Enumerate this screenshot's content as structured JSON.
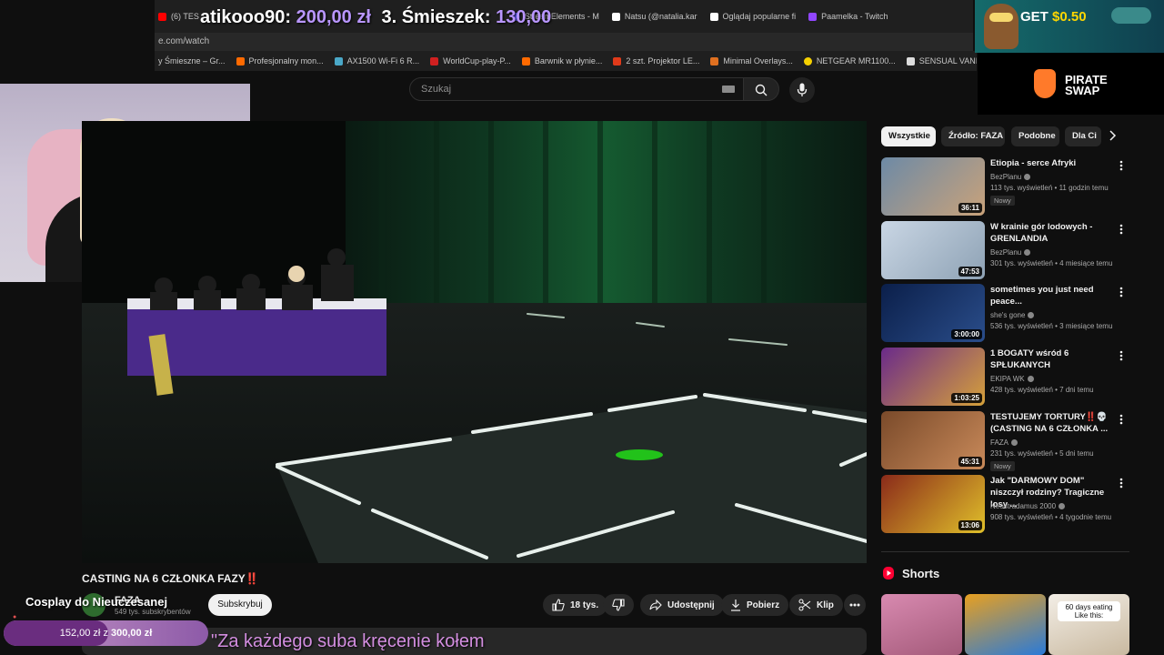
{
  "browser": {
    "tabs": [
      {
        "label": "(6) TES",
        "color": "#ff0000"
      },
      {
        "label": "StreamElements - M",
        "color": "#5c5cff"
      },
      {
        "label": "Natsu (@natalia.kar",
        "color": "#ffffff"
      },
      {
        "label": "Oglądaj popularne fi",
        "color": "#ffffff"
      },
      {
        "label": "Paamelka - Twitch",
        "color": "#9146ff"
      }
    ],
    "url": "e.com/watch",
    "bookmarks": [
      {
        "label": "y Śmieszne – Gr...",
        "color": "#777777"
      },
      {
        "label": "Profesjonalny mon...",
        "color": "#ff6a00"
      },
      {
        "label": "AX1500 Wi-Fi 6 R...",
        "color": "#4aa8c8"
      },
      {
        "label": "WorldCup-play-P...",
        "color": "#d02020"
      },
      {
        "label": "Barwnik w płynie...",
        "color": "#ff6a00"
      },
      {
        "label": "2 szt. Projektor LE...",
        "color": "#e03a1a"
      },
      {
        "label": "Minimal Overlays...",
        "color": "#e07020"
      },
      {
        "label": "NETGEAR MR1100...",
        "color": "#f5d000"
      },
      {
        "label": "SENSUAL VANILL...",
        "color": "#dddddd"
      }
    ]
  },
  "overlay": {
    "donation_user": "atikooo90:",
    "donation_amount": "200,00 zł",
    "donation_rank": "3.",
    "donation_user2": "Śmieszek:",
    "donation_amount2": "130,00",
    "ad_text": "GET",
    "ad_value": "$0.50",
    "logo_line1": "PIRATE",
    "logo_line2": "SWAP",
    "goal_title": "Cosplay do Nieuczesanej",
    "goal_current": "152,00 zł",
    "goal_sep": "z",
    "goal_target": "300,00 zł",
    "goal_progress": 0.51,
    "ticker": "\"Za każdego suba kręcenie kołem"
  },
  "search": {
    "placeholder": "Szukaj"
  },
  "video": {
    "title": "CASTING NA 6 CZŁONKA FAZY‼️",
    "channel": "FAZA",
    "subscribers": "549 tys. subskrybentów",
    "subscribe_label": "Subskrybuj",
    "likes": "18 tys.",
    "share_label": "Udostępnij",
    "download_label": "Pobierz",
    "clip_label": "Klip"
  },
  "sidebar": {
    "chips": [
      "Wszystkie",
      "Źródło: FAZA",
      "Podobne",
      "Dla Ci"
    ],
    "recommendations": [
      {
        "title": "Etiopia - serce Afryki",
        "channel": "BezPlanu",
        "meta": "113 tys. wyświetleń • 11 godzin temu",
        "badge": "Nowy",
        "duration": "36:11",
        "colors": [
          "#6d8aa6",
          "#c9a27a"
        ]
      },
      {
        "title": "W krainie gór lodowych - GRENLANDIA",
        "channel": "BezPlanu",
        "meta": "301 tys. wyświetleń • 4 miesiące temu",
        "badge": "",
        "duration": "47:53",
        "colors": [
          "#c9d6e4",
          "#8ea2b5"
        ]
      },
      {
        "title": "sometimes you just need peace...",
        "channel": "she's gone",
        "meta": "536 tys. wyświetleń • 3 miesiące temu",
        "badge": "",
        "duration": "3:00:00",
        "colors": [
          "#0b1f4a",
          "#2a4d8a"
        ]
      },
      {
        "title": "1 BOGATY wśród 6 SPŁUKANYCH",
        "channel": "EKIPA WK",
        "meta": "428 tys. wyświetleń • 7 dni temu",
        "badge": "",
        "duration": "1:03:25",
        "colors": [
          "#6a2a8a",
          "#d6a13a"
        ]
      },
      {
        "title": "TESTUJEMY TORTURY‼️💀 (CASTING NA 6 CZŁONKA ...",
        "channel": "FAZA",
        "meta": "231 tys. wyświetleń • 5 dni temu",
        "badge": "Nowy",
        "duration": "45:31",
        "colors": [
          "#7a4a2a",
          "#c98a5a"
        ]
      },
      {
        "title": "Jak \"DARMOWY DOM\" niszczył rodziny? Tragiczne losy ...",
        "channel": "Neostradamus 2000",
        "meta": "908 tys. wyświetleń • 4 tygodnie temu",
        "badge": "",
        "duration": "13:06",
        "colors": [
          "#8a2a1a",
          "#e0c02a"
        ]
      }
    ],
    "shorts_label": "Shorts",
    "shorts": [
      {
        "colors": [
          "#d88ab0",
          "#a45a7a"
        ],
        "caption": ""
      },
      {
        "colors": [
          "#e8a020",
          "#2a7ad8"
        ],
        "caption": ""
      },
      {
        "colors": [
          "#f3eee6",
          "#c9b9a0"
        ],
        "caption": "60 days eating Like this:"
      }
    ]
  }
}
